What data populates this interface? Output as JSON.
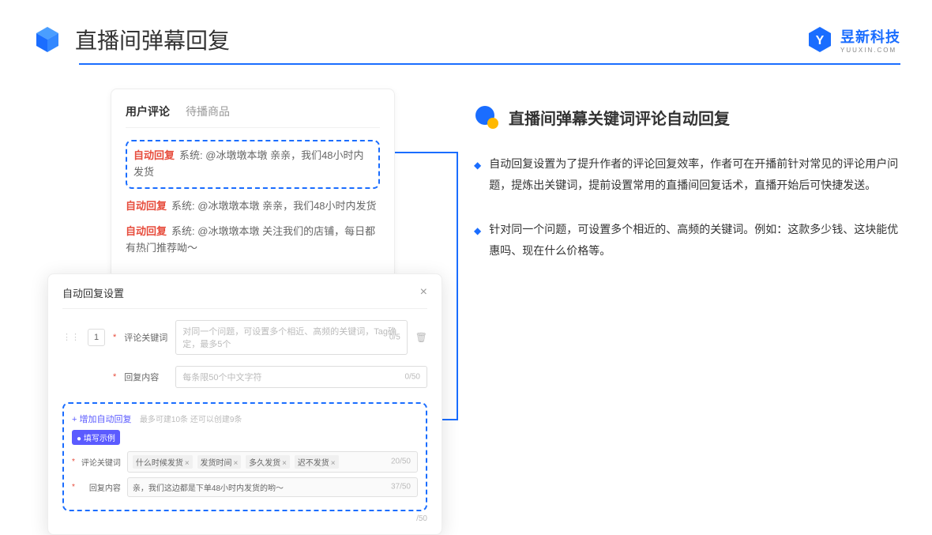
{
  "header": {
    "title": "直播间弹幕回复",
    "brand_name": "昱新科技",
    "brand_sub": "YUUXIN.COM"
  },
  "comments": {
    "tab_user": "用户评论",
    "tab_pending": "待播商品",
    "auto_label": "自动回复",
    "sys_label": "系统:",
    "items": [
      "@冰墩墩本墩 亲亲，我们48小时内发货",
      "@冰墩墩本墩 亲亲，我们48小时内发货",
      "@冰墩墩本墩 关注我们的店铺，每日都有热门推荐呦～"
    ]
  },
  "settings": {
    "title": "自动回复设置",
    "idx": "1",
    "label_keyword": "评论关键词",
    "ph_keyword": "对同一个问题，可设置多个相近、高频的关键词，Tag确定，最多5个",
    "count_keyword": "0/5",
    "label_content": "回复内容",
    "ph_content": "每条限50个中文字符",
    "count_content": "0/50",
    "add_link": "+ 增加自动回复",
    "add_hint": "最多可建10条 还可以创建9条",
    "example_badge": "● 填写示例",
    "ex_label_kw": "评论关键词",
    "ex_tags": [
      "什么时候发货",
      "发货时间",
      "多久发货",
      "迟不发货"
    ],
    "ex_kw_count": "20/50",
    "ex_label_ct": "回复内容",
    "ex_content": "亲，我们这边都是下单48小时内发货的哟～",
    "ex_ct_count": "37/50",
    "outer_count": "/50"
  },
  "right": {
    "section_title": "直播间弹幕关键词评论自动回复",
    "bullets": [
      "自动回复设置为了提升作者的评论回复效率，作者可在开播前针对常见的评论用户问题，提炼出关键词，提前设置常用的直播间回复话术，直播开始后可快捷发送。",
      "针对同一个问题，可设置多个相近的、高频的关键词。例如：这款多少钱、这块能优惠吗、现在什么价格等。"
    ]
  }
}
